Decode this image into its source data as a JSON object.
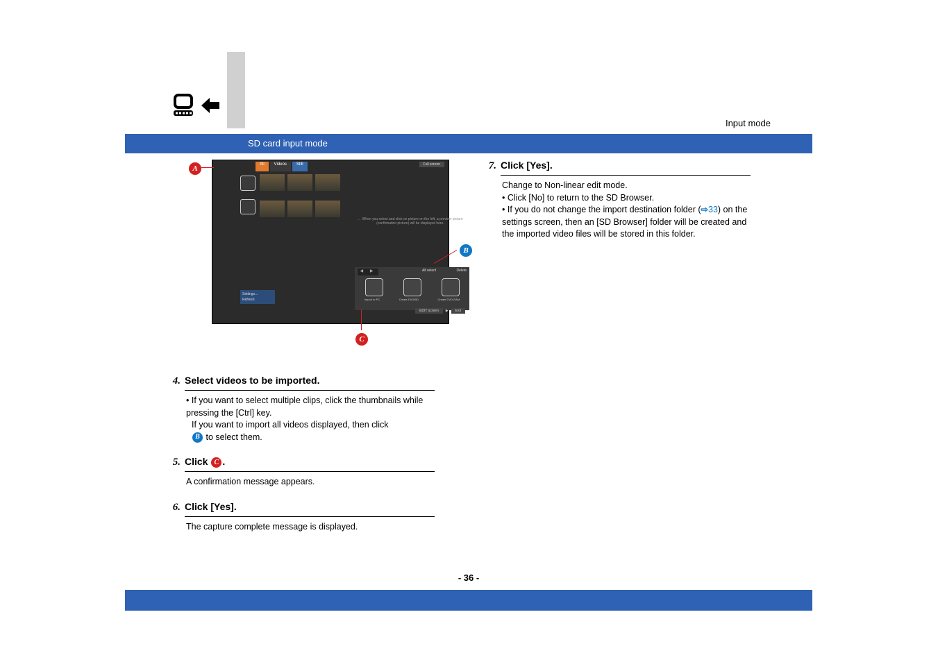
{
  "header": {
    "mode_label": "Input mode",
    "section_title": "SD card input mode"
  },
  "badges": {
    "A": "A",
    "B": "B",
    "C": "C"
  },
  "screenshot": {
    "tabs": {
      "all": "All",
      "videos": "Videos",
      "still": "Still"
    },
    "fullscreen": "Full screen",
    "hint": "← When you select and click on picture on the left, a preview picture (confirmation picture) will be displayed here.",
    "all_select": "All select",
    "delete": "Delete",
    "import_pc": "Import to PC",
    "create_dvd": "Create DVD/BD",
    "create_dvd_ram": "Create DVD-RAM",
    "edit_screen": "EDIT screen",
    "exit": "Exit",
    "settings": "Settings...",
    "refresh": "Refresh"
  },
  "steps": {
    "s4": {
      "num": "4.",
      "title": "Select videos to be imported.",
      "bullet": "If you want to select multiple clips, click the thumbnails while pressing the [Ctrl] key.",
      "line2": "If you want to import all videos displayed, then click",
      "after_badge": " to select them."
    },
    "s5": {
      "num": "5.",
      "title_pre": "Click ",
      "title_post": ".",
      "body": "A confirmation message appears."
    },
    "s6": {
      "num": "6.",
      "title": "Click [Yes].",
      "body": "The capture complete message is displayed."
    },
    "s7": {
      "num": "7.",
      "title": "Click [Yes].",
      "line1": "Change to Non-linear edit mode.",
      "bullet1": "Click [No] to return to the SD Browser.",
      "bullet2_a": "If you do not change the import destination folder (",
      "link_num": "33",
      "bullet2_b": ") on the settings screen, then an [SD Browser] folder will be created and the imported video files will be stored in this folder."
    }
  },
  "page_number": "- 36 -"
}
